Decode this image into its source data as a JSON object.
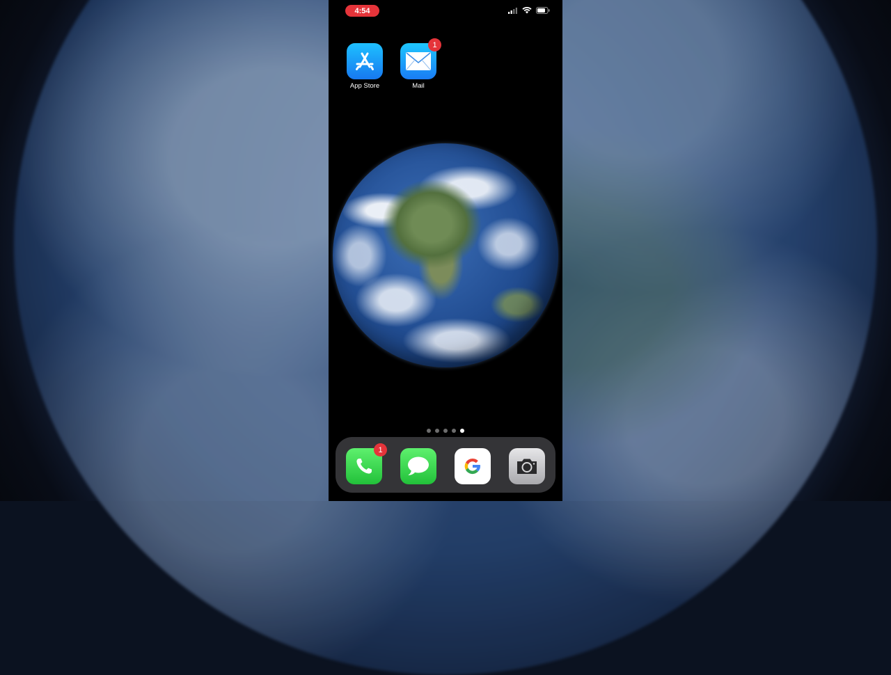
{
  "status_bar": {
    "time": "4:54"
  },
  "home_apps": [
    {
      "label": "App Store",
      "icon": "app-store-icon",
      "badge": null
    },
    {
      "label": "Mail",
      "icon": "mail-icon",
      "badge": "1"
    }
  ],
  "page_indicator": {
    "total": 5,
    "active": 5
  },
  "dock_apps": [
    {
      "name": "Phone",
      "icon": "phone-icon",
      "badge": "1"
    },
    {
      "name": "Messages",
      "icon": "messages-icon",
      "badge": null
    },
    {
      "name": "Google",
      "icon": "google-icon",
      "badge": null
    },
    {
      "name": "Camera",
      "icon": "camera-icon",
      "badge": null
    }
  ],
  "colors": {
    "badge": "#e5343a",
    "recording_pill": "#e5343a",
    "app_store": "#1b8ff5",
    "mail": "#1e8bff",
    "phone": "#34c759",
    "messages": "#34c759"
  }
}
